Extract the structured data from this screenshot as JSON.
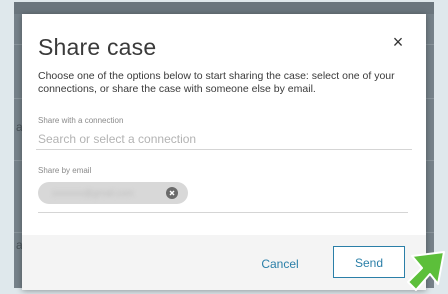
{
  "modal": {
    "title": "Share case",
    "intro": "Choose one of the options below to start sharing the case: select one of your connections, or share the case with someone else by email.",
    "connection_label": "Share with a connection",
    "connection_placeholder": "Search or select a connection",
    "email_label": "Share by email",
    "email_chip_value": "xxxxxxx@gmail.com",
    "cancel_label": "Cancel",
    "send_label": "Send",
    "close_symbol": "×"
  },
  "background": {
    "letter_1": "a",
    "letter_2": "a"
  },
  "icons": {
    "close": "close-icon",
    "chip_remove": "remove-chip-icon",
    "pointer": "arrow-pointer-icon"
  },
  "colors": {
    "accent": "#2b7fa8",
    "arrow": "#5cbf3a"
  }
}
